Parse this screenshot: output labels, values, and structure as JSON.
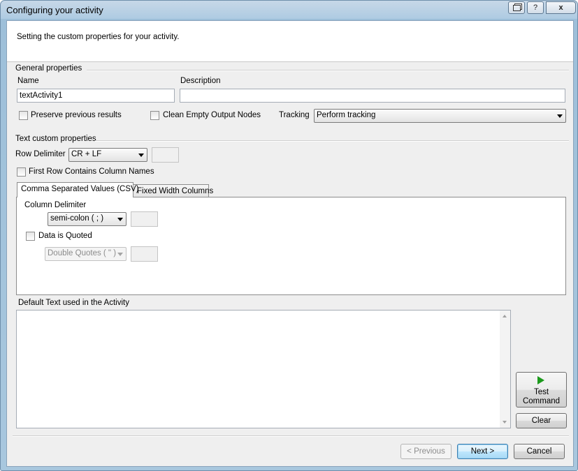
{
  "window": {
    "title": "Configuring your activity",
    "buttons": {
      "restore_icon": "restore-icon",
      "help": "?",
      "close": "x"
    }
  },
  "header": {
    "text": "Setting the custom properties for your activity."
  },
  "general": {
    "title": "General properties",
    "name_label": "Name",
    "name_value": "textActivity1",
    "description_label": "Description",
    "description_value": "",
    "preserve_label": "Preserve previous results",
    "preserve_checked": false,
    "clean_label": "Clean Empty Output Nodes",
    "clean_checked": false,
    "tracking_label": "Tracking",
    "tracking_value": "Perform tracking"
  },
  "text_props": {
    "title": "Text custom properties",
    "row_delimiter_label": "Row Delimiter",
    "row_delimiter_value": "CR + LF",
    "row_delimiter_custom": "",
    "first_row_label": "First Row Contains Column Names",
    "first_row_checked": false,
    "tabs": [
      {
        "label": "Comma Separated Values (CSV)",
        "active": true
      },
      {
        "label": "Fixed Width Columns",
        "active": false
      }
    ],
    "column_delimiter_label": "Column Delimiter",
    "column_delimiter_value": "semi-colon ( ; )",
    "column_delimiter_custom": "",
    "quoted_label": "Data is Quoted",
    "quoted_checked": false,
    "quote_char_value": "Double Quotes ( \" )",
    "quote_char_custom": ""
  },
  "default_text": {
    "label": "Default Text used in the Activity",
    "value": ""
  },
  "actions": {
    "test_command": "Test Command",
    "test_line1": "Test",
    "test_line2": "Command",
    "clear": "Clear",
    "previous": "< Previous",
    "next": "Next >",
    "cancel": "Cancel"
  },
  "colors": {
    "accent": "#3c7fb1",
    "play": "#1c9a1c",
    "chrome": "#aecbe2"
  }
}
